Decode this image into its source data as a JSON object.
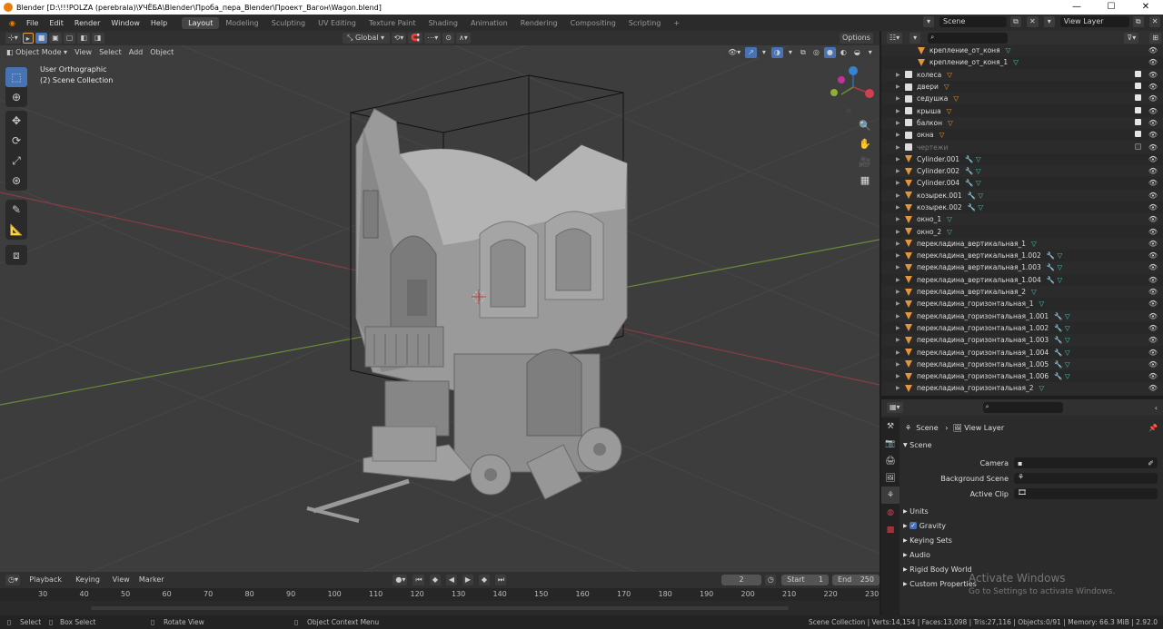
{
  "window": {
    "title": "Blender [D:\\!!!POLZA (perebrala)\\УЧЁБА\\Blender\\Проба_пера_Blender\\Проект_Вагон\\Wagon.blend]"
  },
  "menu": [
    "File",
    "Edit",
    "Render",
    "Window",
    "Help"
  ],
  "workspaces": [
    "Layout",
    "Modeling",
    "Sculpting",
    "UV Editing",
    "Texture Paint",
    "Shading",
    "Animation",
    "Rendering",
    "Compositing",
    "Scripting"
  ],
  "active_workspace": "Layout",
  "topright": {
    "scene_label": "Scene",
    "view_layer_label": "View Layer"
  },
  "viewport_header": {
    "transform_orientation": "Global",
    "options_label": "Options",
    "mode": "Object Mode",
    "menu": [
      "View",
      "Select",
      "Add",
      "Object"
    ]
  },
  "viewport": {
    "view_name": "User Orthographic",
    "collection_label": "(2) Scene Collection"
  },
  "outliner": {
    "search_placeholder": "",
    "rows": [
      {
        "name": "крепление_от_коня",
        "icon": "triangle",
        "mods": "mesh",
        "indent": 2,
        "dim": false
      },
      {
        "name": "крепление_от_коня_1",
        "icon": "triangle",
        "mods": "mesh",
        "indent": 2,
        "dim": false
      },
      {
        "name": "колеса",
        "icon": "collection",
        "mods": "tri",
        "indent": 1,
        "checkbox": true
      },
      {
        "name": "двери",
        "icon": "collection",
        "mods": "tri",
        "indent": 1,
        "checkbox": true
      },
      {
        "name": "седушка",
        "icon": "collection",
        "mods": "tri",
        "indent": 1,
        "checkbox": true
      },
      {
        "name": "крыша",
        "icon": "collection",
        "mods": "tri",
        "indent": 1,
        "checkbox": true
      },
      {
        "name": "балкон",
        "icon": "collection",
        "mods": "tri",
        "indent": 1,
        "checkbox": true
      },
      {
        "name": "окна",
        "icon": "collection",
        "mods": "tri",
        "indent": 1,
        "checkbox": true
      },
      {
        "name": "чертежи",
        "icon": "collection",
        "mods": "",
        "indent": 1,
        "checkbox": false,
        "dim": true
      },
      {
        "name": "Cylinder.001",
        "icon": "triangle",
        "mods": "wr-mesh",
        "indent": 1
      },
      {
        "name": "Cylinder.002",
        "icon": "triangle",
        "mods": "wr-mesh",
        "indent": 1
      },
      {
        "name": "Cylinder.004",
        "icon": "triangle",
        "mods": "wr-mesh",
        "indent": 1
      },
      {
        "name": "козырек.001",
        "icon": "triangle",
        "mods": "wr-mesh",
        "indent": 1
      },
      {
        "name": "козырек.002",
        "icon": "triangle",
        "mods": "wr-mesh",
        "indent": 1
      },
      {
        "name": "окно_1",
        "icon": "triangle",
        "mods": "mesh",
        "indent": 1
      },
      {
        "name": "окно_2",
        "icon": "triangle",
        "mods": "mesh",
        "indent": 1
      },
      {
        "name": "перекладина_вертикальная_1",
        "icon": "triangle",
        "mods": "mesh",
        "indent": 1
      },
      {
        "name": "перекладина_вертикальная_1.002",
        "icon": "triangle",
        "mods": "wr-mesh",
        "indent": 1
      },
      {
        "name": "перекладина_вертикальная_1.003",
        "icon": "triangle",
        "mods": "wr-mesh",
        "indent": 1
      },
      {
        "name": "перекладина_вертикальная_1.004",
        "icon": "triangle",
        "mods": "wr-mesh",
        "indent": 1
      },
      {
        "name": "перекладина_вертикальная_2",
        "icon": "triangle",
        "mods": "mesh",
        "indent": 1
      },
      {
        "name": "перекладина_горизонтальная_1",
        "icon": "triangle",
        "mods": "mesh",
        "indent": 1
      },
      {
        "name": "перекладина_горизонтальная_1.001",
        "icon": "triangle",
        "mods": "wr-mesh",
        "indent": 1
      },
      {
        "name": "перекладина_горизонтальная_1.002",
        "icon": "triangle",
        "mods": "wr-mesh",
        "indent": 1
      },
      {
        "name": "перекладина_горизонтальная_1.003",
        "icon": "triangle",
        "mods": "wr-mesh",
        "indent": 1
      },
      {
        "name": "перекладина_горизонтальная_1.004",
        "icon": "triangle",
        "mods": "wr-mesh",
        "indent": 1
      },
      {
        "name": "перекладина_горизонтальная_1.005",
        "icon": "triangle",
        "mods": "wr-mesh",
        "indent": 1
      },
      {
        "name": "перекладина_горизонтальная_1.006",
        "icon": "triangle",
        "mods": "wr-mesh",
        "indent": 1
      },
      {
        "name": "перекладина_горизонтальная_2",
        "icon": "triangle",
        "mods": "mesh",
        "indent": 1
      }
    ]
  },
  "properties": {
    "breadcrumb": {
      "scene": "Scene",
      "view_layer": "View Layer"
    },
    "section": "Scene",
    "fields": [
      {
        "label": "Camera",
        "value": ""
      },
      {
        "label": "Background Scene",
        "value": ""
      },
      {
        "label": "Active Clip",
        "value": ""
      }
    ],
    "panels": [
      "Units",
      "Gravity",
      "Keying Sets",
      "Audio",
      "Rigid Body World",
      "Custom Properties"
    ],
    "gravity_checked": true
  },
  "timeline": {
    "menu": [
      "Playback",
      "Keying",
      "View",
      "Marker"
    ],
    "current_frame": "2",
    "start_label": "Start",
    "start": "1",
    "end_label": "End",
    "end": "250",
    "ruler": [
      "30",
      "40",
      "50",
      "60",
      "70",
      "80",
      "90",
      "100",
      "110",
      "120",
      "130",
      "140",
      "150",
      "160",
      "170",
      "180",
      "190",
      "200",
      "210",
      "220",
      "230"
    ]
  },
  "statusbar": {
    "select": "Select",
    "box_select": "Box Select",
    "rotate_view": "Rotate View",
    "context_menu": "Object Context Menu",
    "stats": "Scene Collection | Verts:14,154 | Faces:13,098 | Tris:27,116 | Objects:0/91 | Memory: 66.3 MiB | 2.92.0"
  },
  "watermark": {
    "line1": "Activate Windows",
    "line2": "Go to Settings to activate Windows."
  },
  "colors": {
    "accent": "#4772b3",
    "viewport_bg": "#3d3d3d",
    "x_axis": "#c0404a",
    "y_axis": "#7aa43a"
  }
}
